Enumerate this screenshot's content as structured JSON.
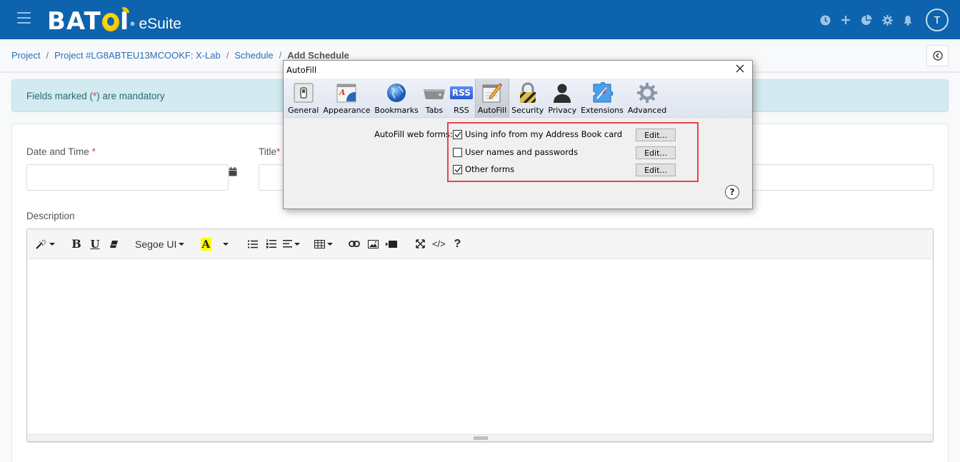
{
  "header": {
    "logo_text": "BATOI",
    "logo_suffix": "eSuite",
    "user_initial": "T",
    "icons": [
      "clock-icon",
      "plus-icon",
      "pie-chart-icon",
      "gear-icon",
      "bell-icon"
    ],
    "bar_color": "#0d63ad"
  },
  "breadcrumb": {
    "items": [
      "Project",
      "Project #LG8ABTEU13MCOOKF: X-Lab",
      "Schedule"
    ],
    "current": "Add Schedule",
    "separator": "/"
  },
  "alert": {
    "text_before": "Fields marked (",
    "asterisk": "*",
    "text_after": ") are mandatory"
  },
  "form": {
    "date_label": "Date and Time",
    "title_label": "Title",
    "required_mark": "*",
    "description_label": "Description",
    "date_value": "",
    "title_value": ""
  },
  "editor": {
    "font_name": "Segoe UI",
    "toolbar": [
      "magic-wand",
      "bold",
      "underline",
      "eraser",
      "font-family",
      "highlight-color",
      "unordered-list",
      "ordered-list",
      "align",
      "table",
      "link",
      "image",
      "video",
      "fullscreen",
      "code-view",
      "help"
    ],
    "content": ""
  },
  "dialog": {
    "title": "AutoFill",
    "tabs": [
      {
        "label": "General",
        "icon": "general-switch-icon"
      },
      {
        "label": "Appearance",
        "icon": "appearance-icon"
      },
      {
        "label": "Bookmarks",
        "icon": "globe-icon"
      },
      {
        "label": "Tabs",
        "icon": "tabs-icon"
      },
      {
        "label": "RSS",
        "icon": "rss-icon"
      },
      {
        "label": "AutoFill",
        "icon": "autofill-pencil-icon",
        "active": true
      },
      {
        "label": "Security",
        "icon": "lock-icon"
      },
      {
        "label": "Privacy",
        "icon": "person-icon"
      },
      {
        "label": "Extensions",
        "icon": "puzzle-compass-icon"
      },
      {
        "label": "Advanced",
        "icon": "gear-icon"
      }
    ],
    "rss_badge": "RSS",
    "section_label": "AutoFill web forms:",
    "options": [
      {
        "label": "Using info from my Address Book card",
        "checked": true,
        "button": "Edit..."
      },
      {
        "label": "User names and passwords",
        "checked": false,
        "button": "Edit..."
      },
      {
        "label": "Other forms",
        "checked": true,
        "button": "Edit..."
      }
    ],
    "help_label": "?",
    "highlight_color": "#e8434b"
  }
}
